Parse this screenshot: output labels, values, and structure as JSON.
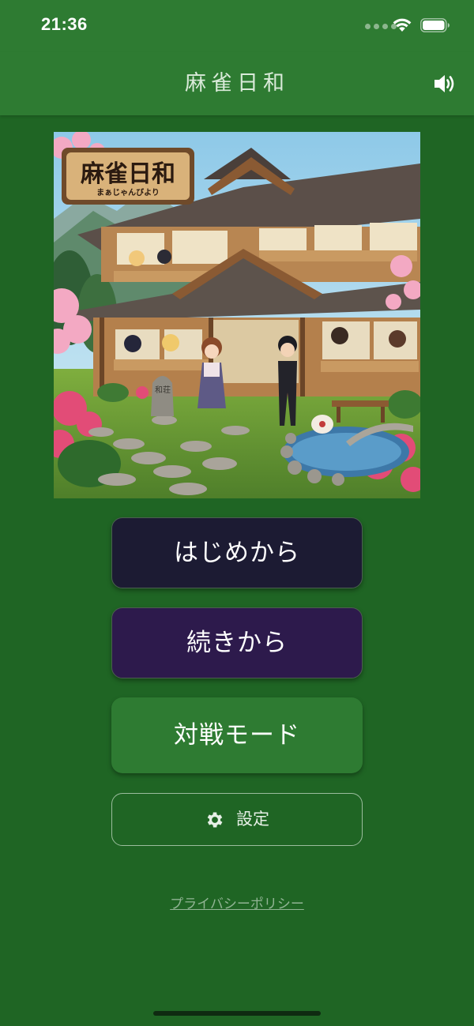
{
  "status_bar": {
    "time": "21:36",
    "icons": [
      "signal-dots-icon",
      "wifi-icon",
      "battery-icon"
    ]
  },
  "header": {
    "title": "麻雀日和",
    "sound_icon": "speaker-volume-icon"
  },
  "hero": {
    "sign_title": "麻雀日和",
    "sign_subtitle": "まぁじゃんびより",
    "stone_text": "和荘"
  },
  "menu": {
    "start_label": "はじめから",
    "continue_label": "続きから",
    "versus_label": "対戦モード",
    "settings_label": "設定",
    "settings_icon": "gear-icon"
  },
  "footer": {
    "privacy_label": "プライバシーポリシー"
  },
  "colors": {
    "background": "#1f6524",
    "header": "#2e7b32",
    "start_button": "#1c1b33",
    "continue_button": "#2d1a4c",
    "versus_button": "#2e7b32"
  }
}
